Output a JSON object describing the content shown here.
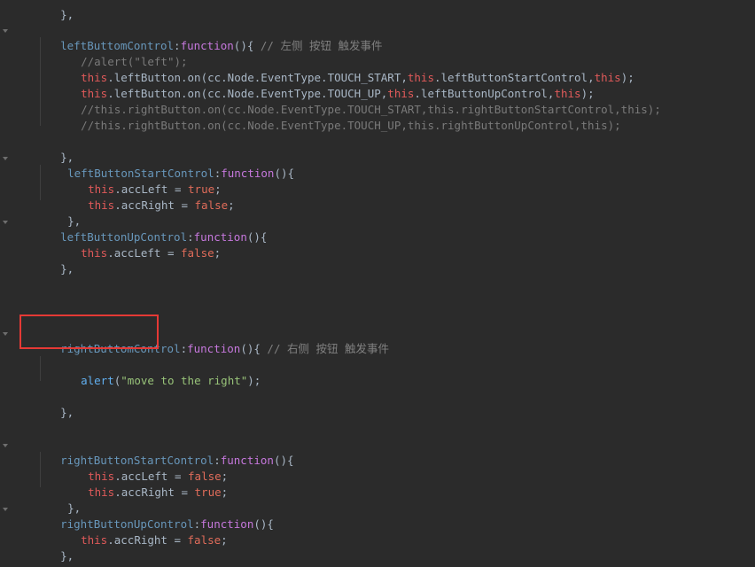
{
  "code": {
    "l0": "},",
    "l1_name": "leftButtomControl",
    "l1_colon": ":",
    "l1_fn": "function",
    "l1_paren": "(){",
    "l1_cmt": " // 左侧 按钮 触发事件",
    "l2": "//alert(\"left\");",
    "l3_this": "this",
    "l3_a": ".leftButton.on(cc.Node.EventType.TOUCH_START,",
    "l3_this2": "this",
    "l3_b": ".leftButtonStartControl,",
    "l3_this3": "this",
    "l3_c": ");",
    "l4_this": "this",
    "l4_a": ".leftButton.on(cc.Node.EventType.TOUCH_UP,",
    "l4_this2": "this",
    "l4_b": ".leftButtonUpControl,",
    "l4_this3": "this",
    "l4_c": ");",
    "l5": "//this.rightButton.on(cc.Node.EventType.TOUCH_START,this.rightButtonStartControl,this);",
    "l6": "//this.rightButton.on(cc.Node.EventType.TOUCH_UP,this.rightButtonUpControl,this);",
    "l8": "},",
    "l9_name": "leftButtonStartControl",
    "l9_colon": ":",
    "l9_fn": "function",
    "l9_paren": "(){",
    "l10_this": "this",
    "l10_a": ".accLeft = ",
    "l10_val": "true",
    "l10_end": ";",
    "l11_this": "this",
    "l11_a": ".accRight = ",
    "l11_val": "false",
    "l11_end": ";",
    "l12": "},",
    "l13_name": "leftButtonUpControl",
    "l13_colon": ":",
    "l13_fn": "function",
    "l13_paren": "(){",
    "l14_this": "this",
    "l14_a": ".accLeft = ",
    "l14_val": "false",
    "l14_end": ";",
    "l15": "},",
    "l20_name": "rightButtomControl",
    "l20_colon": ":",
    "l20_fn": "function",
    "l20_paren": "(){",
    "l20_cmt": " // 右侧 按钮 触发事件",
    "l22_fn": "alert",
    "l22_open": "(",
    "l22_str": "\"move to the right\"",
    "l22_close": ");",
    "l24": "},",
    "l27_name": "rightButtonStartControl",
    "l27_colon": ":",
    "l27_fn": "function",
    "l27_paren": "(){",
    "l28_this": "this",
    "l28_a": ".accLeft = ",
    "l28_val": "false",
    "l28_end": ";",
    "l29_this": "this",
    "l29_a": ".accRight = ",
    "l29_val": "true",
    "l29_end": ";",
    "l30": "},",
    "l31_name": "rightButtonUpControl",
    "l31_colon": ":",
    "l31_fn": "function",
    "l31_paren": "(){",
    "l32_this": "this",
    "l32_a": ".accRight = ",
    "l32_val": "false",
    "l32_end": ";",
    "l33": "},"
  },
  "colors": {
    "background": "#2b2b2b",
    "highlight": "#e53935",
    "property": "#6897bb",
    "keyword": "#c678dd",
    "this": "#e05a5a",
    "string": "#98c379",
    "comment": "#808080"
  }
}
